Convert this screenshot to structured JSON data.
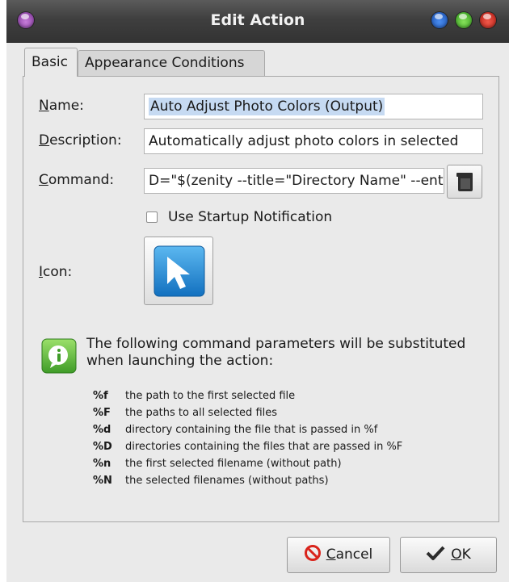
{
  "window": {
    "title": "Edit Action"
  },
  "tabs": [
    {
      "label": "Basic",
      "active": true
    },
    {
      "label": "Appearance Conditions",
      "active": false
    }
  ],
  "form": {
    "name": {
      "label_first": "N",
      "label_rest": "ame:",
      "value": "Auto Adjust Photo Colors (Output)"
    },
    "description": {
      "label_first": "D",
      "label_rest": "escription:",
      "value": "Automatically adjust photo colors in selected"
    },
    "command": {
      "label_first": "C",
      "label_rest": "ommand:",
      "value": "D=\"$(zenity --title=\"Directory Name\" --entry)\""
    },
    "startup_notification": {
      "label": "Use Startup Notification",
      "checked": false
    },
    "icon": {
      "label_first": "I",
      "label_rest": "con:",
      "icon_name": "pointer-arrow-icon"
    }
  },
  "info": {
    "icon_name": "info-icon",
    "text": "The following command parameters will be substituted when launching the action:"
  },
  "parameters": [
    {
      "code": "%f",
      "description": "the path to the first selected file"
    },
    {
      "code": "%F",
      "description": "the paths to all selected files"
    },
    {
      "code": "%d",
      "description": "directory containing the file that is passed in %f"
    },
    {
      "code": "%D",
      "description": "directories containing the files that are passed in %F"
    },
    {
      "code": "%n",
      "description": "the first selected filename (without path)"
    },
    {
      "code": "%N",
      "description": "the selected filenames (without paths)"
    }
  ],
  "buttons": {
    "cancel": {
      "mnemonic": "C",
      "rest": "ancel",
      "icon_name": "cancel-icon"
    },
    "ok": {
      "mnemonic": "O",
      "rest": "K",
      "icon_name": "checkmark-icon"
    }
  },
  "colors": {
    "titlebar": "#3f3f3f",
    "window_bg": "#eaeaea",
    "selection": "#c6daf2",
    "info_green": "#6cc24a",
    "icon_blue": "#1e88d8",
    "cancel_red": "#d9241c"
  }
}
